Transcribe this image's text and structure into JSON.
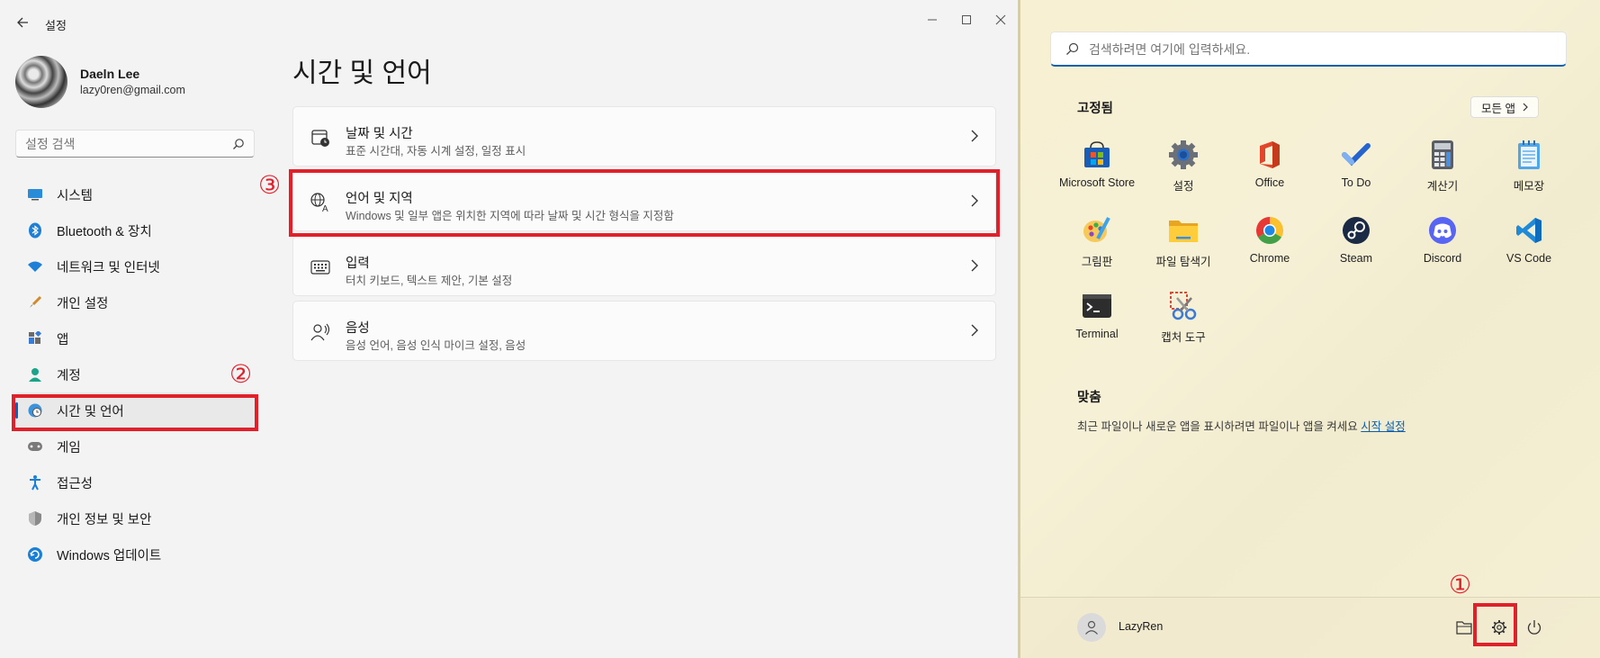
{
  "settings": {
    "app_title": "설정",
    "profile": {
      "name": "Daeln Lee",
      "email": "lazy0ren@gmail.com"
    },
    "search_placeholder": "설정 검색",
    "nav": [
      {
        "label": "시스템",
        "icon": "monitor-icon"
      },
      {
        "label": "Bluetooth & 장치",
        "icon": "bluetooth-icon"
      },
      {
        "label": "네트워크 및 인터넷",
        "icon": "wifi-icon"
      },
      {
        "label": "개인 설정",
        "icon": "brush-icon"
      },
      {
        "label": "앱",
        "icon": "apps-icon"
      },
      {
        "label": "계정",
        "icon": "person-icon"
      },
      {
        "label": "시간 및 언어",
        "icon": "globe-clock-icon",
        "active": true
      },
      {
        "label": "게임",
        "icon": "gamepad-icon"
      },
      {
        "label": "접근성",
        "icon": "accessibility-icon"
      },
      {
        "label": "개인 정보 및 보안",
        "icon": "shield-icon"
      },
      {
        "label": "Windows 업데이트",
        "icon": "update-icon"
      }
    ],
    "page_title": "시간 및 언어",
    "cards": [
      {
        "title": "날짜 및 시간",
        "desc": "표준 시간대, 자동 시계 설정, 일정 표시",
        "icon": "calendar-clock-icon"
      },
      {
        "title": "언어 및 지역",
        "desc": "Windows 및 일부 앱은 위치한 지역에 따라 날짜 및 시간 형식을 지정함",
        "icon": "language-icon"
      },
      {
        "title": "입력",
        "desc": "터치 키보드, 텍스트 제안, 기본 설정",
        "icon": "keyboard-icon"
      },
      {
        "title": "음성",
        "desc": "음성 언어, 음성 인식 마이크 설정, 음성",
        "icon": "speech-icon"
      }
    ]
  },
  "annotations": {
    "step1": "①",
    "step2": "②",
    "step3": "③",
    "color": "#e0202b"
  },
  "start": {
    "search_placeholder": "검색하려면 여기에 입력하세요.",
    "pinned_heading": "고정됨",
    "all_apps_label": "모든 앱",
    "apps": [
      {
        "label": "Microsoft Store",
        "icon": "store-icon"
      },
      {
        "label": "설정",
        "icon": "settings-gear-icon"
      },
      {
        "label": "Office",
        "icon": "office-icon"
      },
      {
        "label": "To Do",
        "icon": "todo-icon"
      },
      {
        "label": "계산기",
        "icon": "calculator-icon"
      },
      {
        "label": "메모장",
        "icon": "notepad-icon"
      },
      {
        "label": "그림판",
        "icon": "paint-icon"
      },
      {
        "label": "파일 탐색기",
        "icon": "folder-icon"
      },
      {
        "label": "Chrome",
        "icon": "chrome-icon"
      },
      {
        "label": "Steam",
        "icon": "steam-icon"
      },
      {
        "label": "Discord",
        "icon": "discord-icon"
      },
      {
        "label": "VS Code",
        "icon": "vscode-icon"
      },
      {
        "label": "Terminal",
        "icon": "terminal-icon"
      },
      {
        "label": "캡처 도구",
        "icon": "snipping-tool-icon"
      }
    ],
    "recommended_heading": "맞춤",
    "recommended_text": "최근 파일이나 새로운 앱을 표시하려면 파일이나 앱을 켜세요 ",
    "recommended_link": "시작 설정",
    "user_name": "LazyRen"
  }
}
